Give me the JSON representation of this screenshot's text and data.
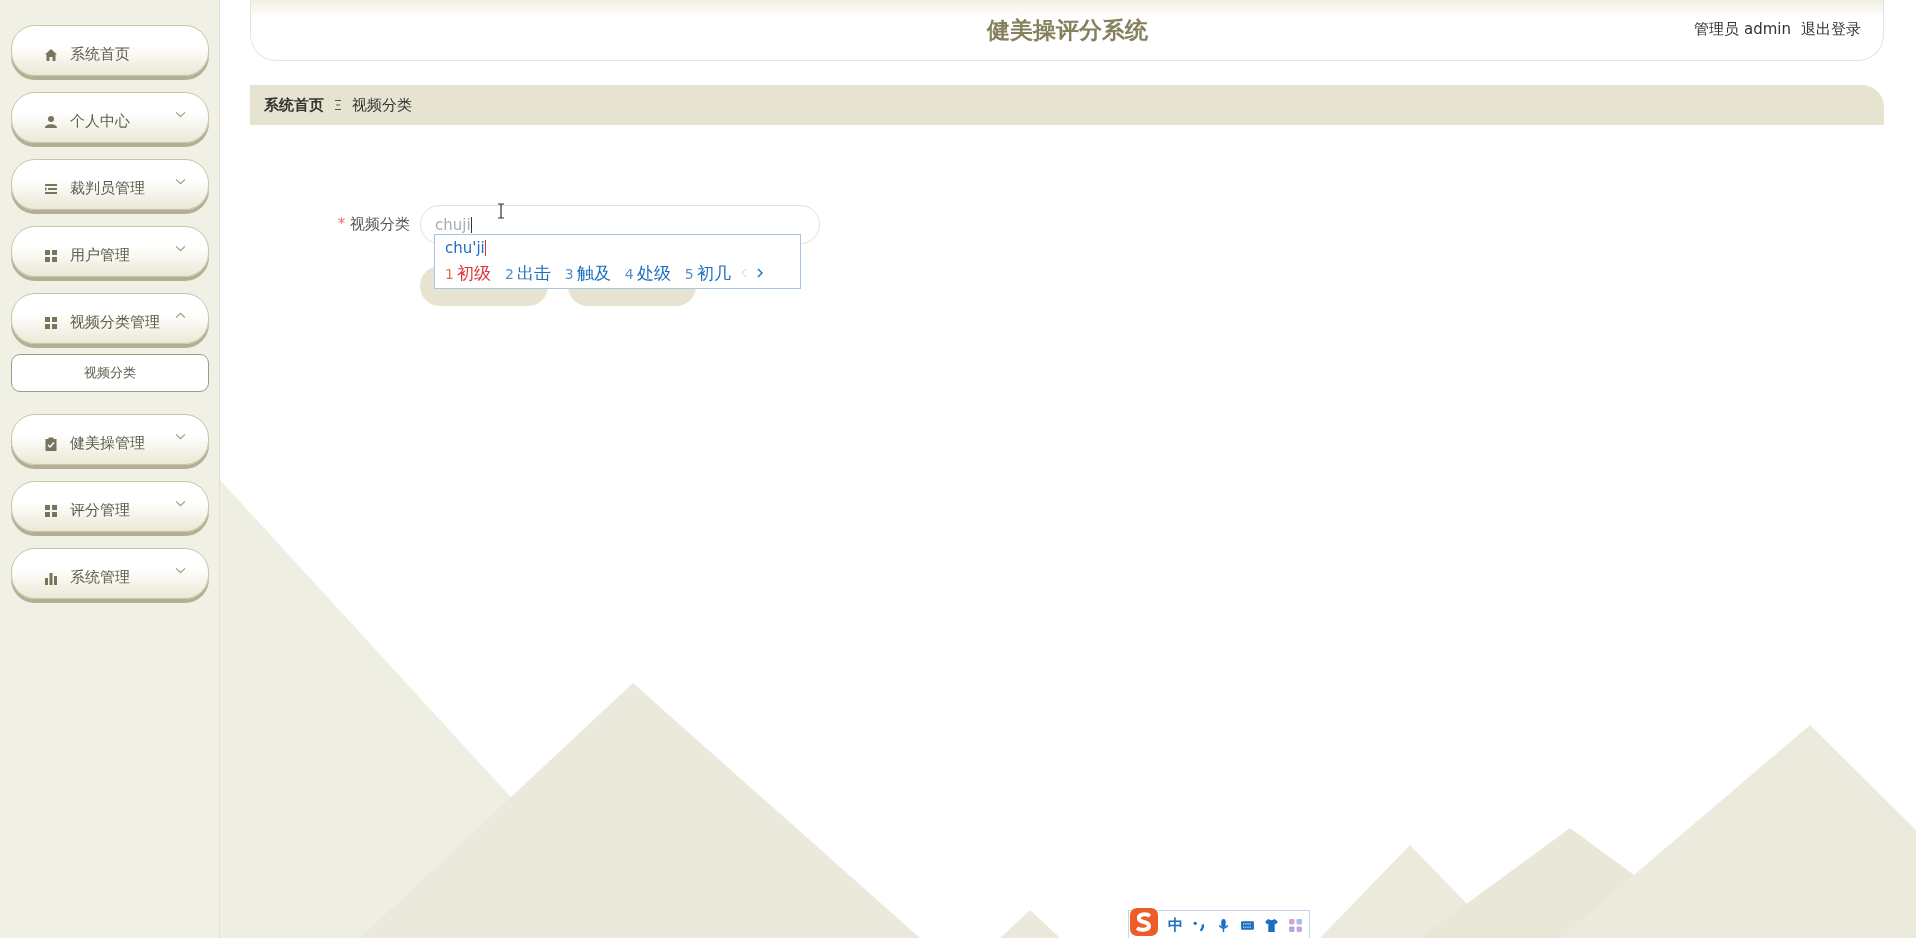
{
  "sidebar": {
    "items": [
      {
        "label": "系统首页"
      },
      {
        "label": "个人中心",
        "expanded": false
      },
      {
        "label": "裁判员管理",
        "expanded": false
      },
      {
        "label": "用户管理",
        "expanded": false
      },
      {
        "label": "视频分类管理",
        "expanded": true,
        "children": [
          {
            "label": "视频分类"
          }
        ]
      },
      {
        "label": "健美操管理",
        "expanded": false
      },
      {
        "label": "评分管理",
        "expanded": false
      },
      {
        "label": "系统管理",
        "expanded": false
      }
    ]
  },
  "header": {
    "title": "健美操评分系统",
    "user": "管理员 admin",
    "logout": "退出登录"
  },
  "breadcrumb": [
    {
      "label": "系统首页"
    },
    {
      "label": "视频分类"
    }
  ],
  "form": {
    "fields": [
      {
        "label": "视频分类",
        "required_mark": "*",
        "value": "chuji"
      }
    ]
  },
  "ime": {
    "composition": "chu'ji",
    "candidates": [
      {
        "index": "1",
        "text": "初级",
        "selected": true
      },
      {
        "index": "2",
        "text": "出击",
        "selected": false
      },
      {
        "index": "3",
        "text": "触及",
        "selected": false
      },
      {
        "index": "4",
        "text": "处级",
        "selected": false
      },
      {
        "index": "5",
        "text": "初几",
        "selected": false
      }
    ],
    "toolbar_mode": "中"
  }
}
